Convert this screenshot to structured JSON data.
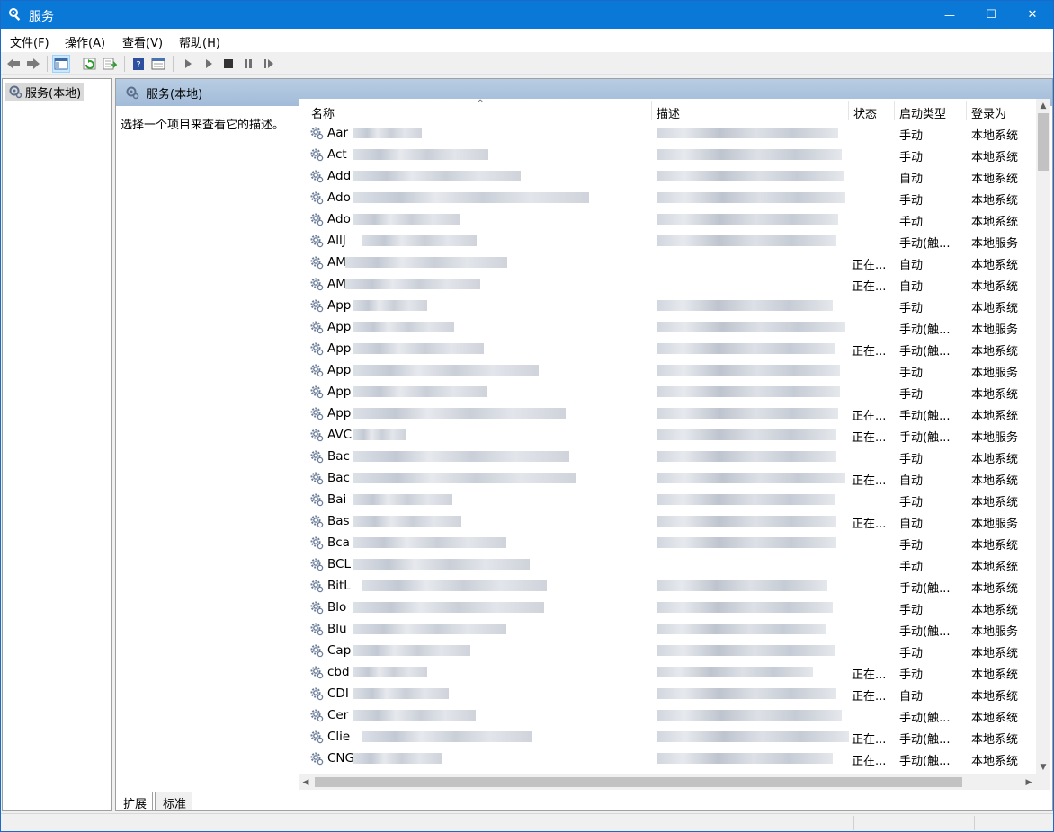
{
  "window": {
    "title": "服务",
    "minimize_glyph": "—",
    "maximize_glyph": "☐",
    "close_glyph": "✕"
  },
  "menu": [
    "文件(F)",
    "操作(A)",
    "查看(V)",
    "帮助(H)"
  ],
  "toolbar": {
    "icons": [
      "back-icon",
      "forward-icon",
      "show-hide-console-tree-icon",
      "refresh-icon",
      "export-list-icon",
      "help-icon",
      "properties-icon",
      "start-service-icon",
      "start-service-alt-icon",
      "stop-service-icon",
      "pause-service-icon",
      "resume-service-icon"
    ]
  },
  "tree": {
    "root_label": "服务(本地)"
  },
  "pane": {
    "header": "服务(本地)",
    "description_hint": "选择一个项目来查看它的描述。"
  },
  "list": {
    "columns": [
      "名称",
      "描述",
      "状态",
      "启动类型",
      "登录为"
    ],
    "sort_indicator": "^",
    "rows": [
      {
        "name": "Aar",
        "status": "",
        "startup": "手动",
        "logon": "本地系统"
      },
      {
        "name": "Act",
        "status": "",
        "startup": "手动",
        "logon": "本地系统"
      },
      {
        "name": "Add",
        "status": "",
        "startup": "自动",
        "logon": "本地系统"
      },
      {
        "name": "Ado",
        "status": "",
        "startup": "手动",
        "logon": "本地系统"
      },
      {
        "name": "Ado",
        "status": "",
        "startup": "手动",
        "logon": "本地系统"
      },
      {
        "name": "AllJ",
        "status": "",
        "startup": "手动(触...",
        "logon": "本地服务"
      },
      {
        "name": "AM",
        "status": "正在...",
        "startup": "自动",
        "logon": "本地系统"
      },
      {
        "name": "AM",
        "status": "正在...",
        "startup": "自动",
        "logon": "本地系统"
      },
      {
        "name": "App",
        "status": "",
        "startup": "手动",
        "logon": "本地系统"
      },
      {
        "name": "App",
        "status": "",
        "startup": "手动(触...",
        "logon": "本地服务"
      },
      {
        "name": "App",
        "status": "正在...",
        "startup": "手动(触...",
        "logon": "本地系统"
      },
      {
        "name": "App",
        "status": "",
        "startup": "手动",
        "logon": "本地服务"
      },
      {
        "name": "App",
        "status": "",
        "startup": "手动",
        "logon": "本地系统"
      },
      {
        "name": "App",
        "status": "正在...",
        "startup": "手动(触...",
        "logon": "本地系统"
      },
      {
        "name": "AVC",
        "status": "正在...",
        "startup": "手动(触...",
        "logon": "本地服务"
      },
      {
        "name": "Bac",
        "status": "",
        "startup": "手动",
        "logon": "本地系统"
      },
      {
        "name": "Bac",
        "status": "正在...",
        "startup": "自动",
        "logon": "本地系统"
      },
      {
        "name": "Bai",
        "status": "",
        "startup": "手动",
        "logon": "本地系统"
      },
      {
        "name": "Bas",
        "status": "正在...",
        "startup": "自动",
        "logon": "本地服务"
      },
      {
        "name": "Bca",
        "status": "",
        "startup": "手动",
        "logon": "本地系统"
      },
      {
        "name": "BCL",
        "status": "",
        "startup": "手动",
        "logon": "本地系统"
      },
      {
        "name": "BitL",
        "status": "",
        "startup": "手动(触...",
        "logon": "本地系统"
      },
      {
        "name": "Blo",
        "status": "",
        "startup": "手动",
        "logon": "本地系统"
      },
      {
        "name": "Blu",
        "status": "",
        "startup": "手动(触...",
        "logon": "本地服务"
      },
      {
        "name": "Cap",
        "status": "",
        "startup": "手动",
        "logon": "本地系统"
      },
      {
        "name": "cbd",
        "status": "正在...",
        "startup": "手动",
        "logon": "本地系统"
      },
      {
        "name": "CDI",
        "status": "正在...",
        "startup": "自动",
        "logon": "本地系统"
      },
      {
        "name": "Cer",
        "status": "",
        "startup": "手动(触...",
        "logon": "本地系统"
      },
      {
        "name": "Clie",
        "status": "正在...",
        "startup": "手动(触...",
        "logon": "本地系统"
      },
      {
        "name": "CNG",
        "status": "正在...",
        "startup": "手动(触...",
        "logon": "本地系统"
      }
    ]
  },
  "tabs": [
    "扩展",
    "标准"
  ],
  "colors": {
    "titlebar": "#0a78d7",
    "pane_header": "#a9c0dc",
    "tree_selection": "#d9d9d9"
  }
}
